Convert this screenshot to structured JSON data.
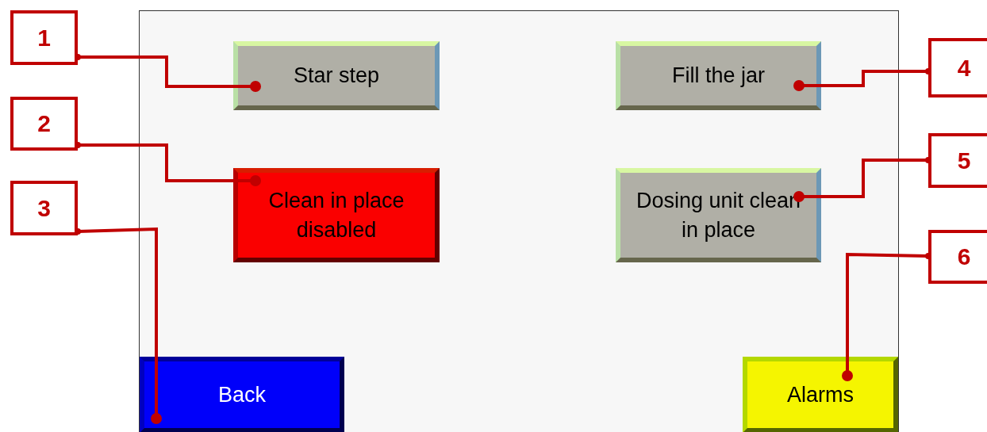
{
  "hmi_screen": {
    "buttons": [
      {
        "label": "Star step",
        "kind": "neutral"
      },
      {
        "label": "Clean in place disabled",
        "kind": "danger"
      },
      {
        "label": "Back",
        "kind": "navigation"
      },
      {
        "label": "Fill the jar",
        "kind": "neutral"
      },
      {
        "label": "Dosing unit clean in place",
        "kind": "neutral"
      },
      {
        "label": "Alarms",
        "kind": "warning"
      }
    ]
  },
  "callouts": [
    {
      "number": "1"
    },
    {
      "number": "2"
    },
    {
      "number": "3"
    },
    {
      "number": "4"
    },
    {
      "number": "5"
    },
    {
      "number": "6"
    }
  ]
}
